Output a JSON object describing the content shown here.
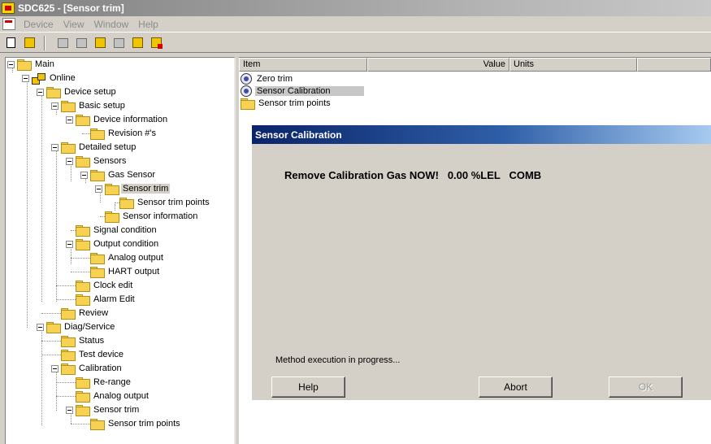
{
  "window": {
    "title": "SDC625 - [Sensor trim]"
  },
  "menu": {
    "items": [
      "Device",
      "View",
      "Window",
      "Help"
    ]
  },
  "tree": {
    "items": [
      {
        "label": "Main"
      },
      {
        "label": "Online"
      },
      {
        "label": "Device setup"
      },
      {
        "label": "Basic setup"
      },
      {
        "label": "Device information"
      },
      {
        "label": "Revision #'s"
      },
      {
        "label": "Detailed setup"
      },
      {
        "label": "Sensors"
      },
      {
        "label": "Gas Sensor"
      },
      {
        "label": "Sensor trim"
      },
      {
        "label": "Sensor trim points"
      },
      {
        "label": "Sensor information"
      },
      {
        "label": "Signal condition"
      },
      {
        "label": "Output condition"
      },
      {
        "label": "Analog output"
      },
      {
        "label": "HART output"
      },
      {
        "label": "Clock edit"
      },
      {
        "label": "Alarm Edit"
      },
      {
        "label": "Review"
      },
      {
        "label": "Diag/Service"
      },
      {
        "label": "Status"
      },
      {
        "label": "Test device"
      },
      {
        "label": "Calibration"
      },
      {
        "label": "Re-range"
      },
      {
        "label": "Analog output"
      },
      {
        "label": "Sensor trim"
      },
      {
        "label": "Sensor trim points"
      }
    ]
  },
  "list": {
    "headers": {
      "item": "Item",
      "value": "Value",
      "units": "Units"
    },
    "rows": [
      {
        "label": "Zero trim"
      },
      {
        "label": "Sensor Calibration"
      },
      {
        "label": "Sensor trim points"
      }
    ]
  },
  "dialog": {
    "title": "Sensor Calibration",
    "message": "Remove Calibration Gas NOW!   0.00 %LEL   COMB",
    "status": "Method execution in progress...",
    "buttons": {
      "help": "Help",
      "abort": "Abort",
      "ok": "OK"
    }
  }
}
